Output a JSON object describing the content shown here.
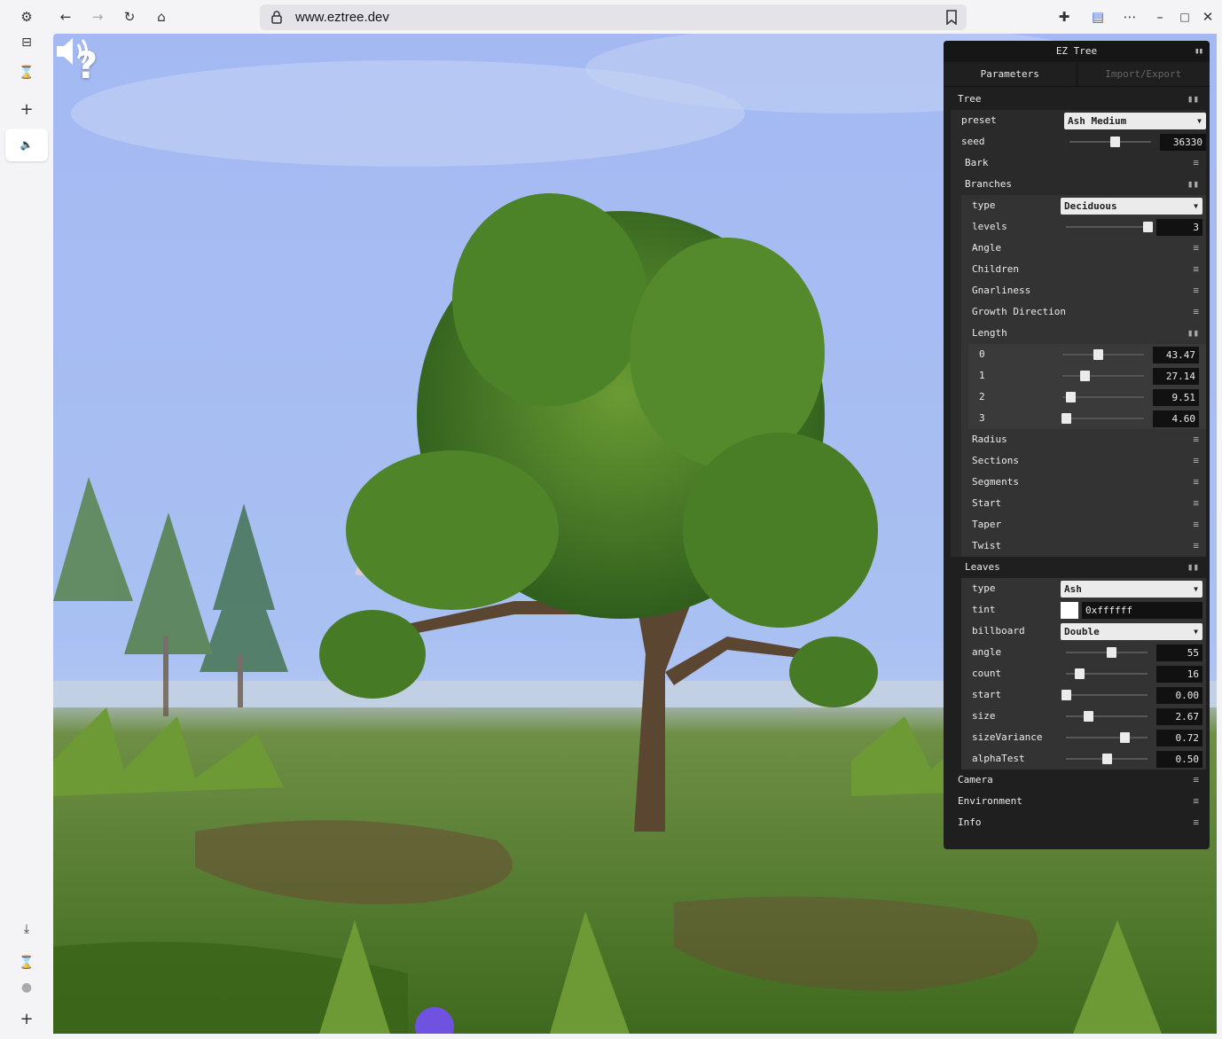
{
  "browser": {
    "url": "www.eztree.dev"
  },
  "scene": {
    "help_symbol": "?"
  },
  "gui": {
    "title": "EZ Tree",
    "tabs": [
      {
        "label": "Parameters",
        "active": true
      },
      {
        "label": "Import/Export",
        "active": false
      }
    ],
    "tree": {
      "title": "Tree",
      "preset_label": "preset",
      "preset_value": "Ash Medium",
      "seed_label": "seed",
      "seed_value": "36330",
      "seed_fraction": 0.55
    },
    "bark": {
      "title": "Bark"
    },
    "branches": {
      "title": "Branches",
      "type_label": "type",
      "type_value": "Deciduous",
      "levels_label": "levels",
      "levels_value": "3",
      "levels_fraction": 1.0,
      "subfolders": [
        "Angle",
        "Children",
        "Gnarliness",
        "Growth Direction"
      ],
      "length": {
        "title": "Length",
        "rows": [
          {
            "label": "0",
            "value": "43.47",
            "fraction": 0.43
          },
          {
            "label": "1",
            "value": "27.14",
            "fraction": 0.27
          },
          {
            "label": "2",
            "value": "9.51",
            "fraction": 0.1
          },
          {
            "label": "3",
            "value": "4.60",
            "fraction": 0.04
          }
        ]
      },
      "subfolders_after": [
        "Radius",
        "Sections",
        "Segments",
        "Start",
        "Taper",
        "Twist"
      ]
    },
    "leaves": {
      "title": "Leaves",
      "type_label": "type",
      "type_value": "Ash",
      "tint_label": "tint",
      "tint_value": "0xffffff",
      "billboard_label": "billboard",
      "billboard_value": "Double",
      "rows": [
        {
          "label": "angle",
          "value": "55",
          "fraction": 0.55
        },
        {
          "label": "count",
          "value": "16",
          "fraction": 0.16
        },
        {
          "label": "start",
          "value": "0.00",
          "fraction": 0.0
        },
        {
          "label": "size",
          "value": "2.67",
          "fraction": 0.27
        },
        {
          "label": "sizeVariance",
          "value": "0.72",
          "fraction": 0.72
        },
        {
          "label": "alphaTest",
          "value": "0.50",
          "fraction": 0.5
        }
      ]
    },
    "bottom_folders": [
      "Camera",
      "Environment",
      "Info"
    ]
  },
  "colors": {
    "sky_top": "#9fb7f0",
    "sky_bottom": "#c9d8f2",
    "grass": "#5f8a2e",
    "panel_bg": "#1f1f1f"
  }
}
